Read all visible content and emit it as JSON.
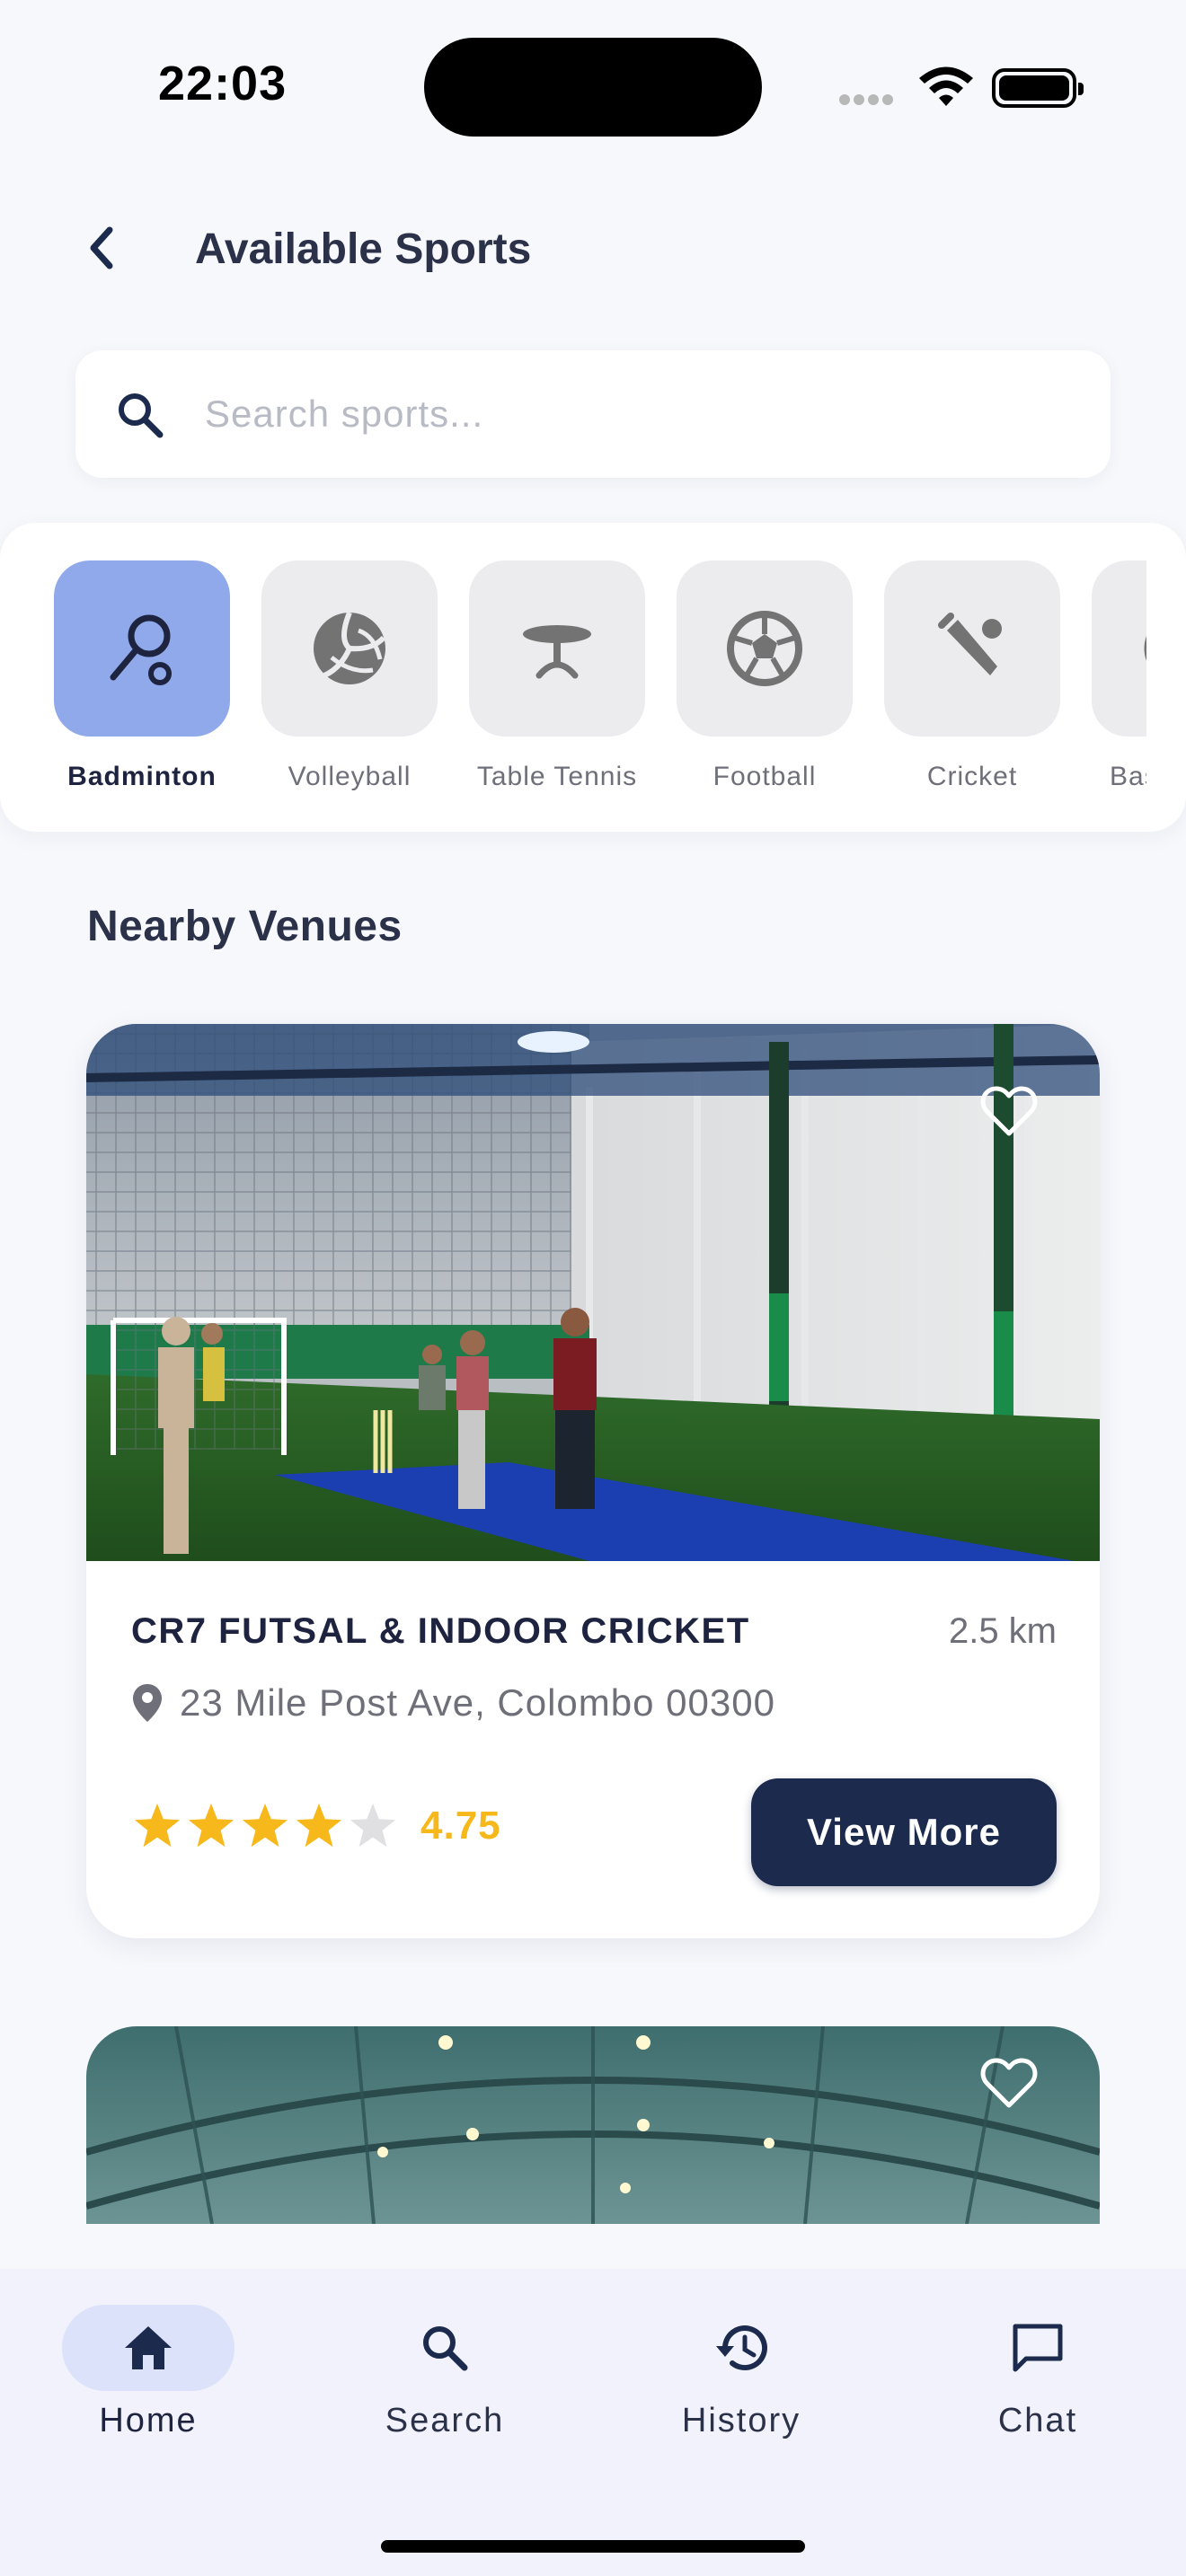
{
  "status_bar": {
    "time": "22:03"
  },
  "header": {
    "title": "Available Sports"
  },
  "search": {
    "placeholder": "Search sports..."
  },
  "categories": [
    {
      "label": "Badminton",
      "icon": "badminton-racket-icon",
      "active": true
    },
    {
      "label": "Volleyball",
      "icon": "volleyball-icon",
      "active": false
    },
    {
      "label": "Table Tennis",
      "icon": "table-tennis-table-icon",
      "active": false
    },
    {
      "label": "Football",
      "icon": "football-icon",
      "active": false
    },
    {
      "label": "Cricket",
      "icon": "cricket-bat-icon",
      "active": false
    },
    {
      "label": "Bas",
      "icon": "basketball-icon",
      "active": false
    }
  ],
  "section": {
    "nearby_title": "Nearby Venues"
  },
  "venues": [
    {
      "name": "CR7 FUTSAL & INDOOR CRICKET",
      "distance": "2.5 km",
      "address": "23 Mile Post Ave, Colombo 00300",
      "rating": "4.75",
      "stars_filled": 4,
      "stars_total": 5,
      "cta": "View More"
    }
  ],
  "nav": [
    {
      "label": "Home",
      "icon": "home-icon",
      "active": true
    },
    {
      "label": "Search",
      "icon": "search-icon",
      "active": false
    },
    {
      "label": "History",
      "icon": "history-icon",
      "active": false
    },
    {
      "label": "Chat",
      "icon": "chat-icon",
      "active": false
    }
  ],
  "colors": {
    "primary": "#1c2a4e",
    "accent_tile": "#8fa9ea",
    "star": "#f6b81a",
    "nav_active_bg": "#dbe2fa"
  }
}
